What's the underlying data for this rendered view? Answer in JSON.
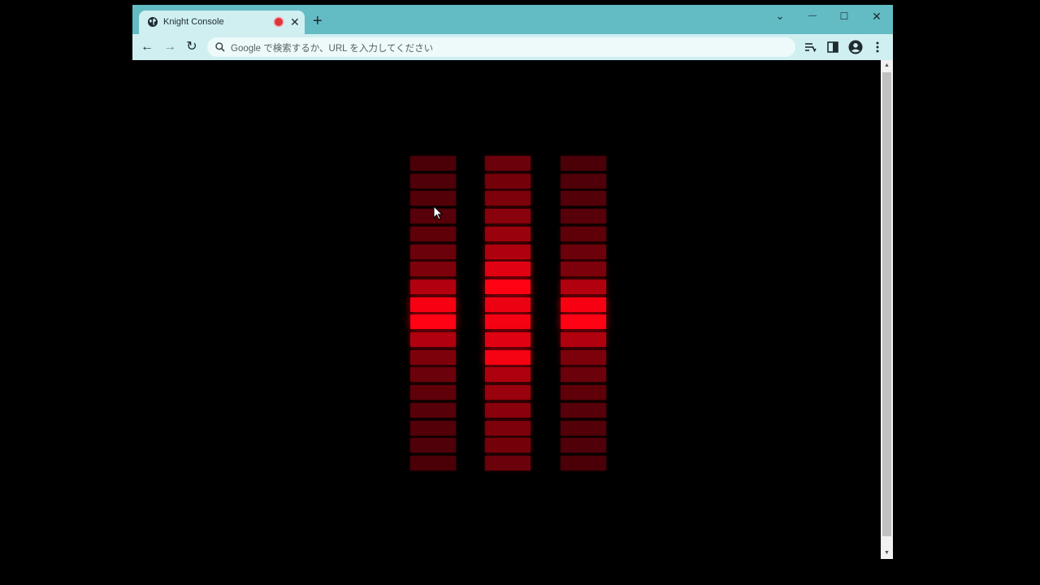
{
  "tab": {
    "title": "Knight Console",
    "close_glyph": "✕",
    "favicon_icon": "globe-icon",
    "recording_indicator_color": "#e0333a"
  },
  "new_tab_glyph": "+",
  "window_controls": {
    "tab_search_glyph": "⌄",
    "minimize_glyph": "—",
    "maximize_glyph": "☐",
    "close_glyph": "✕"
  },
  "toolbar": {
    "back_glyph": "←",
    "forward_glyph": "→",
    "reload_glyph": "↻",
    "omnibox_placeholder": "Google で検索するか、URL を入力してください",
    "right_icons": [
      "reading-list-icon",
      "side-panel-icon",
      "profile-icon",
      "more-menu-icon"
    ]
  },
  "scrollbar": {
    "up_glyph": "▲",
    "down_glyph": "▼"
  },
  "colors": {
    "titlebar": "#63bbc4",
    "tab_active": "#cfeff1",
    "meter_red": "#ff0016"
  },
  "meters": [
    {
      "levels": [
        0.12,
        0.14,
        0.16,
        0.18,
        0.22,
        0.28,
        0.36,
        0.62,
        0.96,
        1.0,
        0.62,
        0.36,
        0.28,
        0.22,
        0.18,
        0.16,
        0.14,
        0.12
      ]
    },
    {
      "levels": [
        0.28,
        0.32,
        0.36,
        0.42,
        0.5,
        0.6,
        0.85,
        1.0,
        0.9,
        0.95,
        0.85,
        0.95,
        0.6,
        0.5,
        0.42,
        0.36,
        0.32,
        0.28
      ]
    },
    {
      "levels": [
        0.12,
        0.14,
        0.16,
        0.18,
        0.22,
        0.28,
        0.36,
        0.62,
        0.96,
        1.0,
        0.62,
        0.36,
        0.28,
        0.22,
        0.18,
        0.16,
        0.14,
        0.12
      ]
    }
  ]
}
